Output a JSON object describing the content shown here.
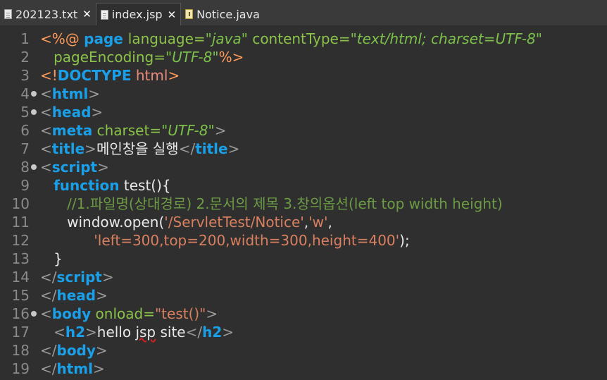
{
  "tabs": [
    {
      "label": "202123.txt",
      "icon": "text-file-icon",
      "closable": true
    },
    {
      "label": "index.jsp",
      "icon": "jsp-file-icon",
      "closable": true,
      "active": true
    },
    {
      "label": "Notice.java",
      "icon": "java-file-icon",
      "closable": false
    }
  ],
  "close_glyph": "✕",
  "lines": [
    {
      "n": "1",
      "fold": false,
      "tokens": [
        [
          "pt",
          "<%@ "
        ],
        [
          "kw",
          "page "
        ],
        [
          "at",
          "language="
        ],
        [
          "st",
          "\"java\""
        ],
        [
          "t",
          " "
        ],
        [
          "at",
          "contentType="
        ],
        [
          "st",
          "\"text/html; charset=UTF-8\""
        ]
      ]
    },
    {
      "n": "2",
      "fold": false,
      "tokens": [
        [
          "t",
          "   "
        ],
        [
          "at",
          "pageEncoding="
        ],
        [
          "st",
          "\"UTF-8\""
        ],
        [
          "pt",
          "%>"
        ]
      ]
    },
    {
      "n": "3",
      "fold": false,
      "tokens": [
        [
          "pt",
          "<!"
        ],
        [
          "kw",
          "DOCTYPE"
        ],
        [
          "t",
          " "
        ],
        [
          "ds",
          "html"
        ],
        [
          "pt",
          ">"
        ]
      ]
    },
    {
      "n": "4",
      "fold": true,
      "tokens": [
        [
          "br",
          "<"
        ],
        [
          "kw",
          "html"
        ],
        [
          "br",
          ">"
        ]
      ]
    },
    {
      "n": "5",
      "fold": true,
      "tokens": [
        [
          "br",
          "<"
        ],
        [
          "kw",
          "head"
        ],
        [
          "br",
          ">"
        ]
      ]
    },
    {
      "n": "6",
      "fold": false,
      "tokens": [
        [
          "br",
          "<"
        ],
        [
          "kw",
          "meta"
        ],
        [
          "t",
          " "
        ],
        [
          "at",
          "charset="
        ],
        [
          "st",
          "\"UTF-8\""
        ],
        [
          "br",
          ">"
        ]
      ]
    },
    {
      "n": "7",
      "fold": false,
      "tokens": [
        [
          "br",
          "<"
        ],
        [
          "kw",
          "title"
        ],
        [
          "br",
          ">"
        ],
        [
          "t",
          "메인창을 실행"
        ],
        [
          "br",
          "</"
        ],
        [
          "kw",
          "title"
        ],
        [
          "br",
          ">"
        ]
      ]
    },
    {
      "n": "8",
      "fold": true,
      "tokens": [
        [
          "br",
          "<"
        ],
        [
          "kw",
          "script"
        ],
        [
          "br",
          ">"
        ]
      ]
    },
    {
      "n": "9",
      "fold": false,
      "tokens": [
        [
          "t",
          "   "
        ],
        [
          "kw",
          "function"
        ],
        [
          "t",
          " test(){"
        ]
      ]
    },
    {
      "n": "10",
      "fold": false,
      "tokens": [
        [
          "t",
          "      "
        ],
        [
          "cm",
          "//1.파일명(상대경로) 2.문서의 제목 3.창의옵션(left top width height)"
        ]
      ]
    },
    {
      "n": "11",
      "fold": false,
      "tokens": [
        [
          "t",
          "      window.open("
        ],
        [
          "s2",
          "'/ServletTest/Notice'"
        ],
        [
          "t",
          ","
        ],
        [
          "s2",
          "'w'"
        ],
        [
          "t",
          ","
        ]
      ]
    },
    {
      "n": "12",
      "fold": false,
      "tokens": [
        [
          "t",
          "            "
        ],
        [
          "s2",
          "'left=300,top=200,width=300,height=400'"
        ],
        [
          "t",
          ");"
        ]
      ]
    },
    {
      "n": "13",
      "fold": false,
      "tokens": [
        [
          "t",
          "   }"
        ]
      ]
    },
    {
      "n": "14",
      "fold": false,
      "tokens": [
        [
          "br",
          "</"
        ],
        [
          "kw",
          "script"
        ],
        [
          "br",
          ">"
        ]
      ]
    },
    {
      "n": "15",
      "fold": false,
      "tokens": [
        [
          "br",
          "</"
        ],
        [
          "kw",
          "head"
        ],
        [
          "br",
          ">"
        ]
      ]
    },
    {
      "n": "16",
      "fold": true,
      "tokens": [
        [
          "br",
          "<"
        ],
        [
          "kw",
          "body"
        ],
        [
          "t",
          " "
        ],
        [
          "at",
          "onload="
        ],
        [
          "s2",
          "\"test()\""
        ],
        [
          "br",
          ">"
        ]
      ]
    },
    {
      "n": "17",
      "fold": false,
      "tokens": [
        [
          "t",
          "   "
        ],
        [
          "br",
          "<"
        ],
        [
          "kw",
          "h2"
        ],
        [
          "br",
          ">"
        ],
        [
          "t",
          "hello "
        ],
        [
          "ul",
          "jsp"
        ],
        [
          "t",
          " site"
        ],
        [
          "br",
          "</"
        ],
        [
          "kw",
          "h2"
        ],
        [
          "br",
          ">"
        ]
      ]
    },
    {
      "n": "18",
      "fold": false,
      "tokens": [
        [
          "br",
          "</"
        ],
        [
          "kw",
          "body"
        ],
        [
          "br",
          ">"
        ]
      ]
    },
    {
      "n": "19",
      "fold": false,
      "tokens": [
        [
          "br",
          "</"
        ],
        [
          "kw",
          "html"
        ],
        [
          "br",
          ">"
        ]
      ]
    }
  ]
}
